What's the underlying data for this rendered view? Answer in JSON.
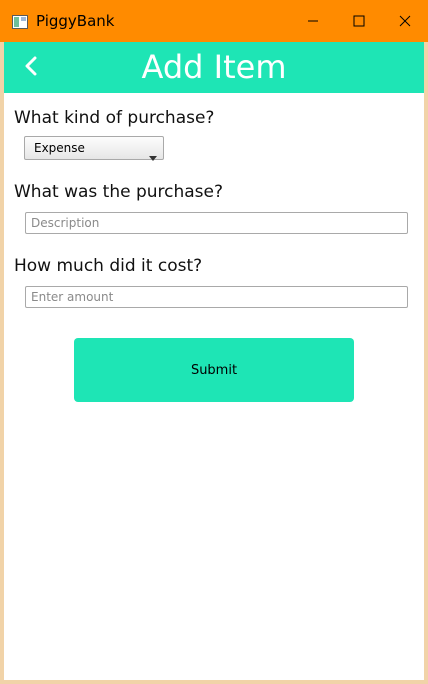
{
  "window": {
    "title": "PiggyBank",
    "icon": "piggybank-app-icon",
    "controls": {
      "minimize_icon": "minimize-icon",
      "maximize_icon": "maximize-icon",
      "close_icon": "close-icon"
    },
    "titlebar_color": "#ff8b00"
  },
  "appbar": {
    "title": "Add Item",
    "back_icon": "chevron-left-icon",
    "color": "#1ee5b5"
  },
  "form": {
    "purchase_type": {
      "question": "What kind of purchase?",
      "selected": "Expense"
    },
    "description": {
      "question": "What was the purchase?",
      "placeholder": "Description",
      "value": ""
    },
    "amount": {
      "question": "How much did it cost?",
      "placeholder": "Enter amount",
      "value": ""
    },
    "submit_label": "Submit",
    "submit_color": "#1ee5b5"
  }
}
